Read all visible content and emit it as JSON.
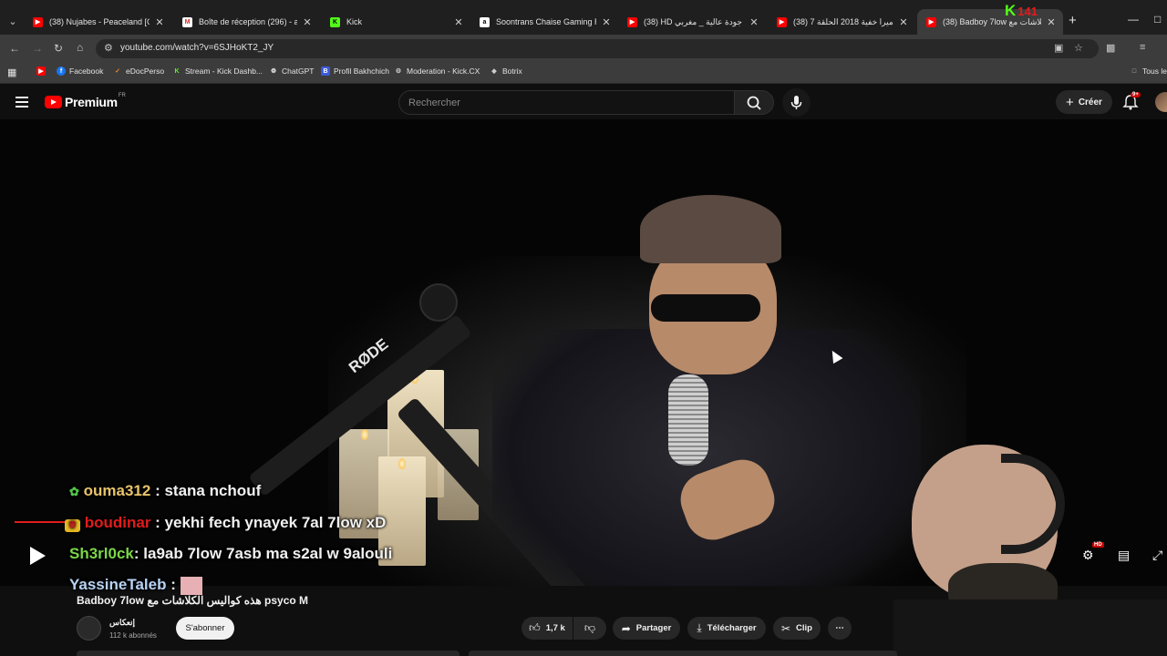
{
  "browser": {
    "tabs": [
      {
        "title": "(38) Nujabes - Peaceland [Offic",
        "favicon": "youtube"
      },
      {
        "title": "Boîte de réception (296) - amin",
        "favicon": "gmail"
      },
      {
        "title": "Kick",
        "favicon": "kick"
      },
      {
        "title": "Soontrans Chaise Gaming Racin",
        "favicon": "amazon"
      },
      {
        "title": "(38) HD جودة عالية _ مغربي",
        "favicon": "youtube"
      },
      {
        "title": "(38) كاميرا خفية 2018 الحلقة 7 e",
        "favicon": "youtube"
      },
      {
        "title": "(38) Badboy 7low الكلاشات مع",
        "favicon": "youtube",
        "active": true
      }
    ],
    "kick_overlay": {
      "letter": "K",
      "count": "141"
    },
    "url": "youtube.com/watch?v=6SJHoKT2_JY",
    "bookmarks": [
      {
        "label": "",
        "icon": "youtube"
      },
      {
        "label": "Facebook",
        "icon": "facebook"
      },
      {
        "label": "eDocPerso",
        "icon": "edocperso"
      },
      {
        "label": "Stream - Kick Dashb...",
        "icon": "kick"
      },
      {
        "label": "ChatGPT",
        "icon": "chatgpt"
      },
      {
        "label": "Profil Bakhchich",
        "icon": "bakhchich"
      },
      {
        "label": "Moderation - Kick.CX",
        "icon": "kickcx"
      },
      {
        "label": "Botrix",
        "icon": "botrix"
      }
    ],
    "bookmarks_right": "Tous le"
  },
  "youtube": {
    "logo_text": "Premium",
    "logo_region": "FR",
    "search_placeholder": "Rechercher",
    "create_label": "Créer",
    "notif_badge": "9+",
    "accent": "#ff0000"
  },
  "chat": [
    {
      "user": "ouma312",
      "sep": " : ",
      "message": "stana nchouf",
      "badge": "leaf-icon"
    },
    {
      "user": "boudinar",
      "sep": " : ",
      "message": "yekhi fech ynayek 7al 7low xD",
      "badge": "crown-icon"
    },
    {
      "user": "Sh3rl0ck",
      "sep": ": ",
      "message": "la9ab 7low 7asb ma s2al w 9alouli",
      "badge": ""
    },
    {
      "user": "YassineTaleb",
      "sep": " : ",
      "message": "",
      "badge": ""
    }
  ],
  "player": {
    "hd_badge": "HD"
  },
  "video": {
    "title": "Badboy 7low هذه كواليس الكلاشات مع psyco M",
    "channel_name": "إنعكاس",
    "channel_subs": "112 k abonnés",
    "subscribe_label": "S'abonner",
    "likes": "1,7 k",
    "share_label": "Partager",
    "download_label": "Télécharger",
    "clip_label": "Clip"
  }
}
